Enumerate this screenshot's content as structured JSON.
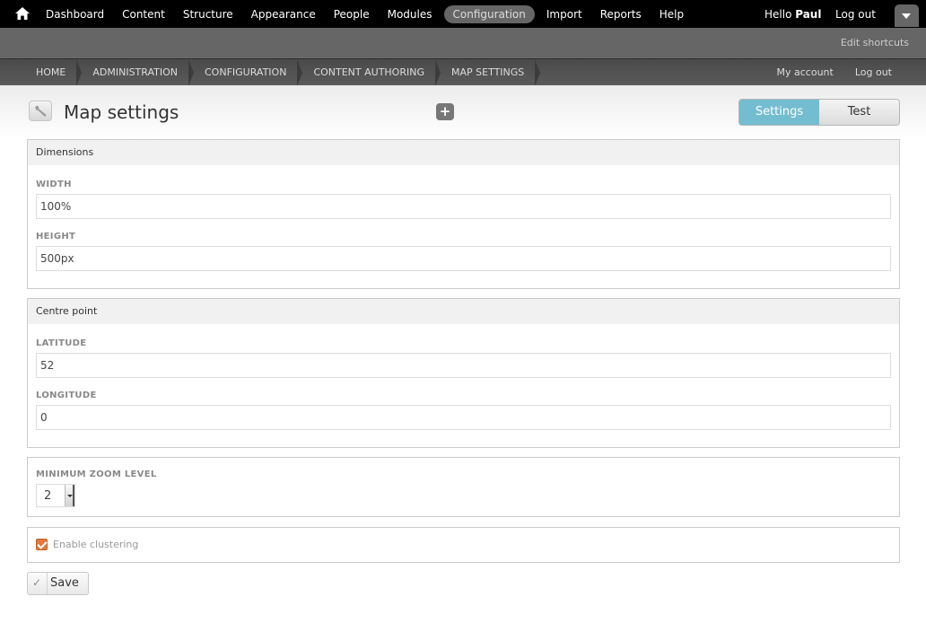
{
  "toolbar": {
    "menu": [
      "Dashboard",
      "Content",
      "Structure",
      "Appearance",
      "People",
      "Modules",
      "Configuration",
      "Import",
      "Reports",
      "Help"
    ],
    "active_item": "Configuration",
    "hello": "Hello ",
    "username": "Paul",
    "logout": "Log out"
  },
  "shortcuts": {
    "edit": "Edit shortcuts"
  },
  "breadcrumb": {
    "items": [
      "HOME",
      "ADMINISTRATION",
      "CONFIGURATION",
      "CONTENT AUTHORING",
      "MAP SETTINGS"
    ],
    "my_account": "My account",
    "logout": "Log out"
  },
  "page": {
    "title": "Map settings",
    "add_shortcut": "+",
    "tabs": [
      "Settings",
      "Test"
    ],
    "active_tab": "Settings"
  },
  "dimensions": {
    "legend": "Dimensions",
    "width_label": "WIDTH",
    "width_value": "100%",
    "height_label": "HEIGHT",
    "height_value": "500px"
  },
  "centre": {
    "legend": "Centre point",
    "lat_label": "LATITUDE",
    "lat_value": "52",
    "lon_label": "LONGITUDE",
    "lon_value": "0"
  },
  "zoom": {
    "label": "MINIMUM ZOOM LEVEL",
    "value": "2"
  },
  "clustering": {
    "label": "Enable clustering",
    "checked": true
  },
  "actions": {
    "save": "Save",
    "check_glyph": "✓"
  },
  "colors": {
    "toolbar_bg": "#000000",
    "shortcut_bg": "#666666",
    "active_tab": "#74bdd0",
    "checkbox": "#e07a40"
  }
}
